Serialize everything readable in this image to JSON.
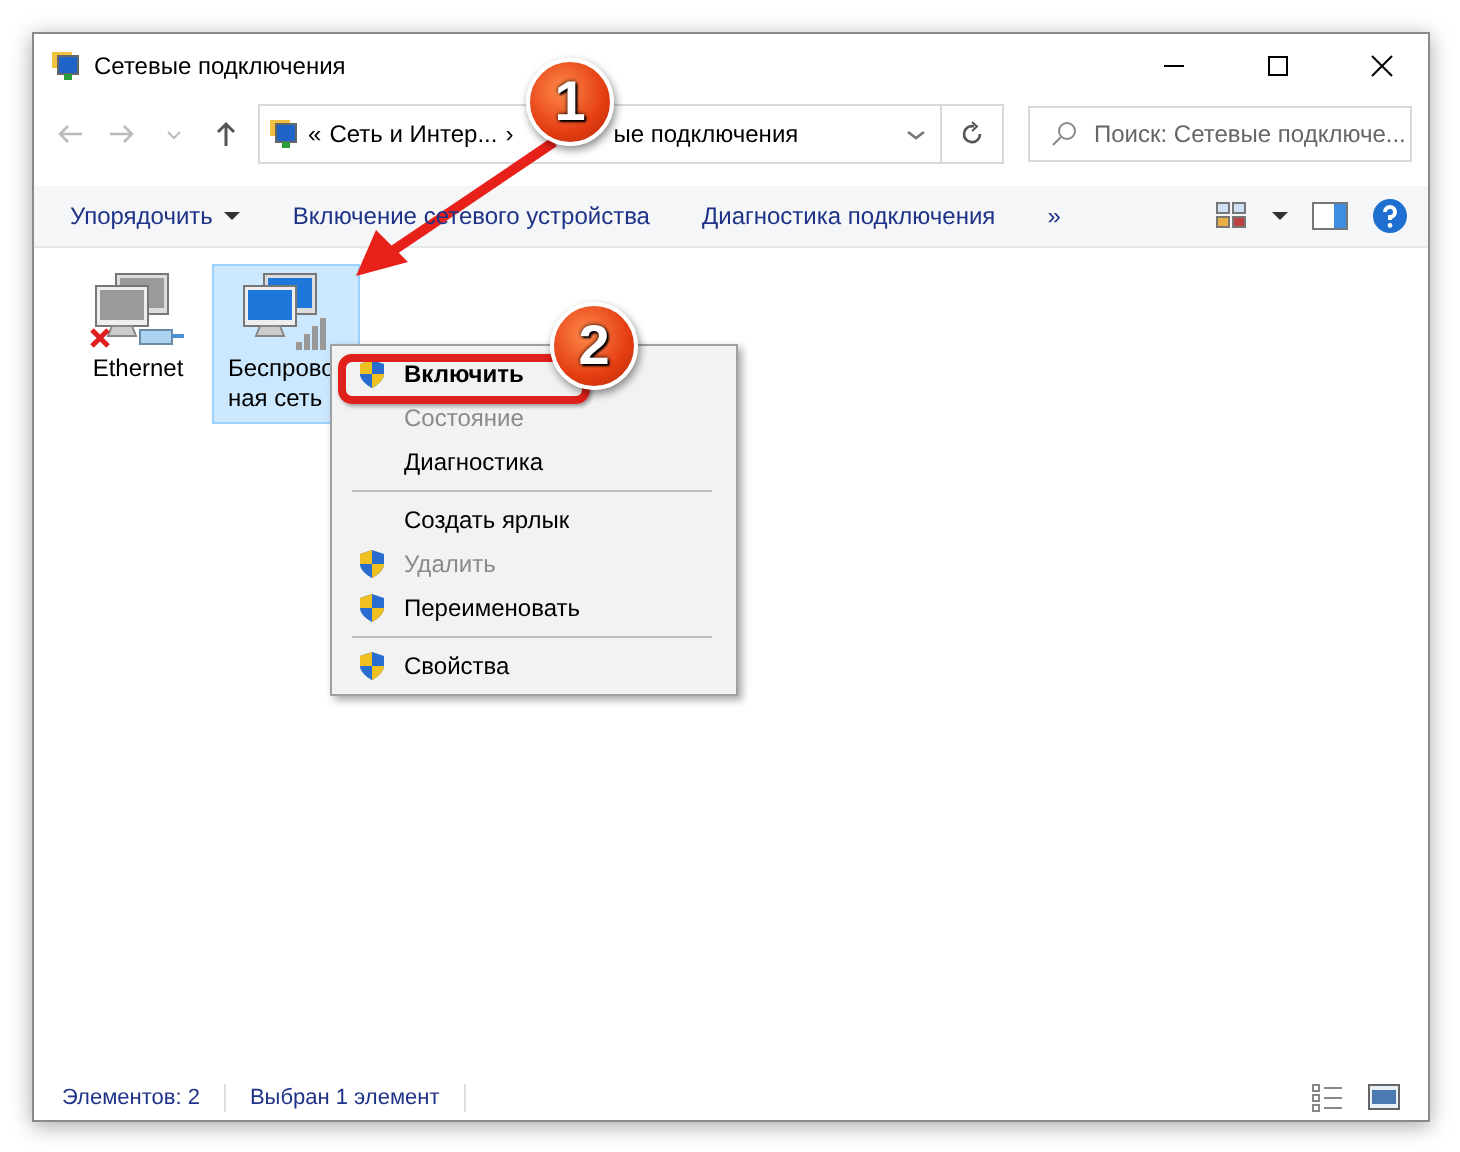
{
  "window": {
    "title": "Сетевые подключения"
  },
  "address": {
    "segments": [
      "«",
      "Сеть и Интер...",
      "›",
      "ые подключения"
    ]
  },
  "search": {
    "placeholder": "Поиск: Сетевые подключе..."
  },
  "toolbar": {
    "items": [
      "Упорядочить",
      "Включение сетевого устройства",
      "Диагностика подключения",
      "»"
    ]
  },
  "connections": [
    {
      "lines": [
        "Ethernet"
      ],
      "kind": "wired",
      "disabled": true,
      "selected": false
    },
    {
      "lines": [
        "Беспрово",
        "ная сеть"
      ],
      "kind": "wireless",
      "disabled": false,
      "selected": true
    }
  ],
  "context_menu": [
    {
      "kind": "item",
      "label": "Включить",
      "default": true,
      "disabled": false,
      "shield": true
    },
    {
      "kind": "item",
      "label": "Состояние",
      "default": false,
      "disabled": true,
      "shield": false
    },
    {
      "kind": "item",
      "label": "Диагностика",
      "default": false,
      "disabled": false,
      "shield": false
    },
    {
      "kind": "separator"
    },
    {
      "kind": "item",
      "label": "Создать ярлык",
      "default": false,
      "disabled": false,
      "shield": false
    },
    {
      "kind": "item",
      "label": "Удалить",
      "default": false,
      "disabled": true,
      "shield": true
    },
    {
      "kind": "item",
      "label": "Переименовать",
      "default": false,
      "disabled": false,
      "shield": true
    },
    {
      "kind": "separator"
    },
    {
      "kind": "item",
      "label": "Свойства",
      "default": false,
      "disabled": false,
      "shield": true
    }
  ],
  "annotations": [
    {
      "label": "1"
    },
    {
      "label": "2"
    }
  ],
  "status_bar": {
    "items": [
      "Элементов: 2",
      "Выбран 1 элемент"
    ]
  }
}
